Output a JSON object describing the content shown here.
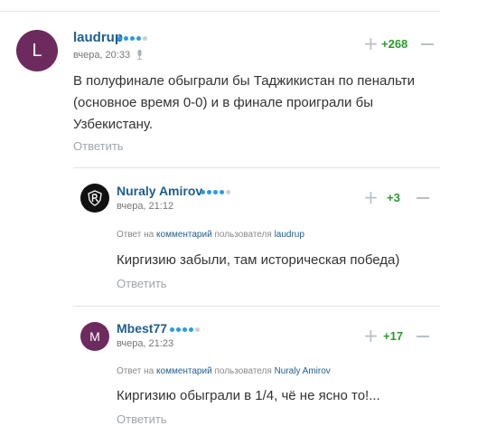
{
  "comments": [
    {
      "username": "laudrup",
      "avatar_letter": "L",
      "avatar_color": "#6d2a5e",
      "rank_filled": 4,
      "rank_total": 5,
      "timestamp": "вчера, 20:33",
      "score": "+268",
      "text": "В полуфинале обыграли бы Таджикистан по пенальти (основное время 0-0) и в финале проиграли бы Узбекистану.",
      "reply_label": "Ответить"
    },
    {
      "username": "Nuraly Amirov",
      "avatar_icon": "team-crest-icon",
      "avatar_color": "#111111",
      "rank_filled": 4,
      "rank_total": 5,
      "timestamp": "вчера, 21:12",
      "score": "+3",
      "answer_prefix": "Ответ на",
      "answer_link": "комментарий",
      "answer_mid": "пользователя",
      "answer_user": "laudrup",
      "text": "Киргизию забыли, там историческая победа)",
      "reply_label": "Ответить"
    },
    {
      "username": "Mbest77",
      "avatar_letter": "M",
      "avatar_color": "#6d2a5e",
      "rank_filled": 4,
      "rank_total": 5,
      "timestamp": "вчера, 21:23",
      "score": "+17",
      "answer_prefix": "Ответ на",
      "answer_link": "комментарий",
      "answer_mid": "пользователя",
      "answer_user": "Nuraly Amirov",
      "text": "Киргизию обыграли в 1/4, чё не ясно то!...",
      "reply_label": "Ответить"
    }
  ],
  "colors": {
    "link": "#1f5e8e",
    "score_positive": "#2e9a2e",
    "rank_on": "#2a9be0",
    "rank_off": "#c7d0d9"
  }
}
